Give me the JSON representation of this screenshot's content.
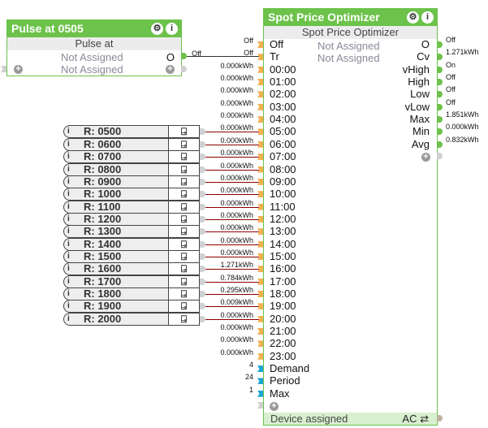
{
  "pulse": {
    "title": "Pulse at 0505",
    "subtitle": "Pulse at",
    "rows": [
      "Not Assigned",
      "Not Assigned"
    ],
    "output_label": "O",
    "output_value": "Off"
  },
  "spo": {
    "title": "Spot Price Optimizer",
    "subtitle": "Spot Price Optimizer",
    "inputs": [
      {
        "label": "Off",
        "value": "Off",
        "kind": "o"
      },
      {
        "label": "Tr",
        "value": "Off",
        "kind": "o"
      },
      {
        "label": "00:00",
        "value": "0.000kWh",
        "kind": "o"
      },
      {
        "label": "01:00",
        "value": "0.000kWh",
        "kind": "o"
      },
      {
        "label": "02:00",
        "value": "0.000kWh",
        "kind": "o"
      },
      {
        "label": "03:00",
        "value": "0.000kWh",
        "kind": "o"
      },
      {
        "label": "04:00",
        "value": "0.000kWh",
        "kind": "o"
      },
      {
        "label": "05:00",
        "value": "0.000kWh",
        "kind": "o"
      },
      {
        "label": "06:00",
        "value": "0.000kWh",
        "kind": "o"
      },
      {
        "label": "07:00",
        "value": "0.000kWh",
        "kind": "o"
      },
      {
        "label": "08:00",
        "value": "0.000kWh",
        "kind": "o"
      },
      {
        "label": "09:00",
        "value": "0.000kWh",
        "kind": "o"
      },
      {
        "label": "10:00",
        "value": "0.000kWh",
        "kind": "o"
      },
      {
        "label": "11:00",
        "value": "0.000kWh",
        "kind": "o"
      },
      {
        "label": "12:00",
        "value": "0.000kWh",
        "kind": "o"
      },
      {
        "label": "13:00",
        "value": "0.000kWh",
        "kind": "o"
      },
      {
        "label": "14:00",
        "value": "0.000kWh",
        "kind": "o"
      },
      {
        "label": "15:00",
        "value": "0.000kWh",
        "kind": "o"
      },
      {
        "label": "16:00",
        "value": "1.271kWh",
        "kind": "o"
      },
      {
        "label": "17:00",
        "value": "0.784kWh",
        "kind": "o"
      },
      {
        "label": "18:00",
        "value": "0.295kWh",
        "kind": "o"
      },
      {
        "label": "19:00",
        "value": "0.009kWh",
        "kind": "o"
      },
      {
        "label": "20:00",
        "value": "0.000kWh",
        "kind": "o"
      },
      {
        "label": "21:00",
        "value": "0.000kWh",
        "kind": "o"
      },
      {
        "label": "22:00",
        "value": "0.000kWh",
        "kind": "o"
      },
      {
        "label": "23:00",
        "value": "0.000kWh",
        "kind": "o"
      },
      {
        "label": "Demand",
        "value": "4",
        "kind": "b"
      },
      {
        "label": "Period",
        "value": "24",
        "kind": "b"
      },
      {
        "label": "Max",
        "value": "1",
        "kind": "b"
      }
    ],
    "not_assigned": [
      "Not Assigned",
      "Not Assigned"
    ],
    "outputs": [
      {
        "label": "O",
        "value": "Off"
      },
      {
        "label": "Cv",
        "value": "1.271kWh"
      },
      {
        "label": "vHigh",
        "value": "On"
      },
      {
        "label": "High",
        "value": "Off"
      },
      {
        "label": "Low",
        "value": "Off"
      },
      {
        "label": "vLow",
        "value": "Off"
      },
      {
        "label": "Max",
        "value": "1.851kWh"
      },
      {
        "label": "Min",
        "value": "0.000kWh"
      },
      {
        "label": "Avg",
        "value": "0.832kWh"
      }
    ],
    "footer": "Device assigned",
    "footer_right": "AC ⇄"
  },
  "readers": [
    "R: 0500",
    "R: 0600",
    "R: 0700",
    "R: 0800",
    "R: 0900",
    "R: 1000",
    "R: 1100",
    "R: 1200",
    "R: 1300",
    "R: 1400",
    "R: 1500",
    "R: 1600",
    "R: 1700",
    "R: 1800",
    "R: 1900",
    "R: 2000"
  ],
  "icons": {
    "settings": "⚙",
    "info": "i",
    "plus": "+",
    "read": "⍈"
  }
}
